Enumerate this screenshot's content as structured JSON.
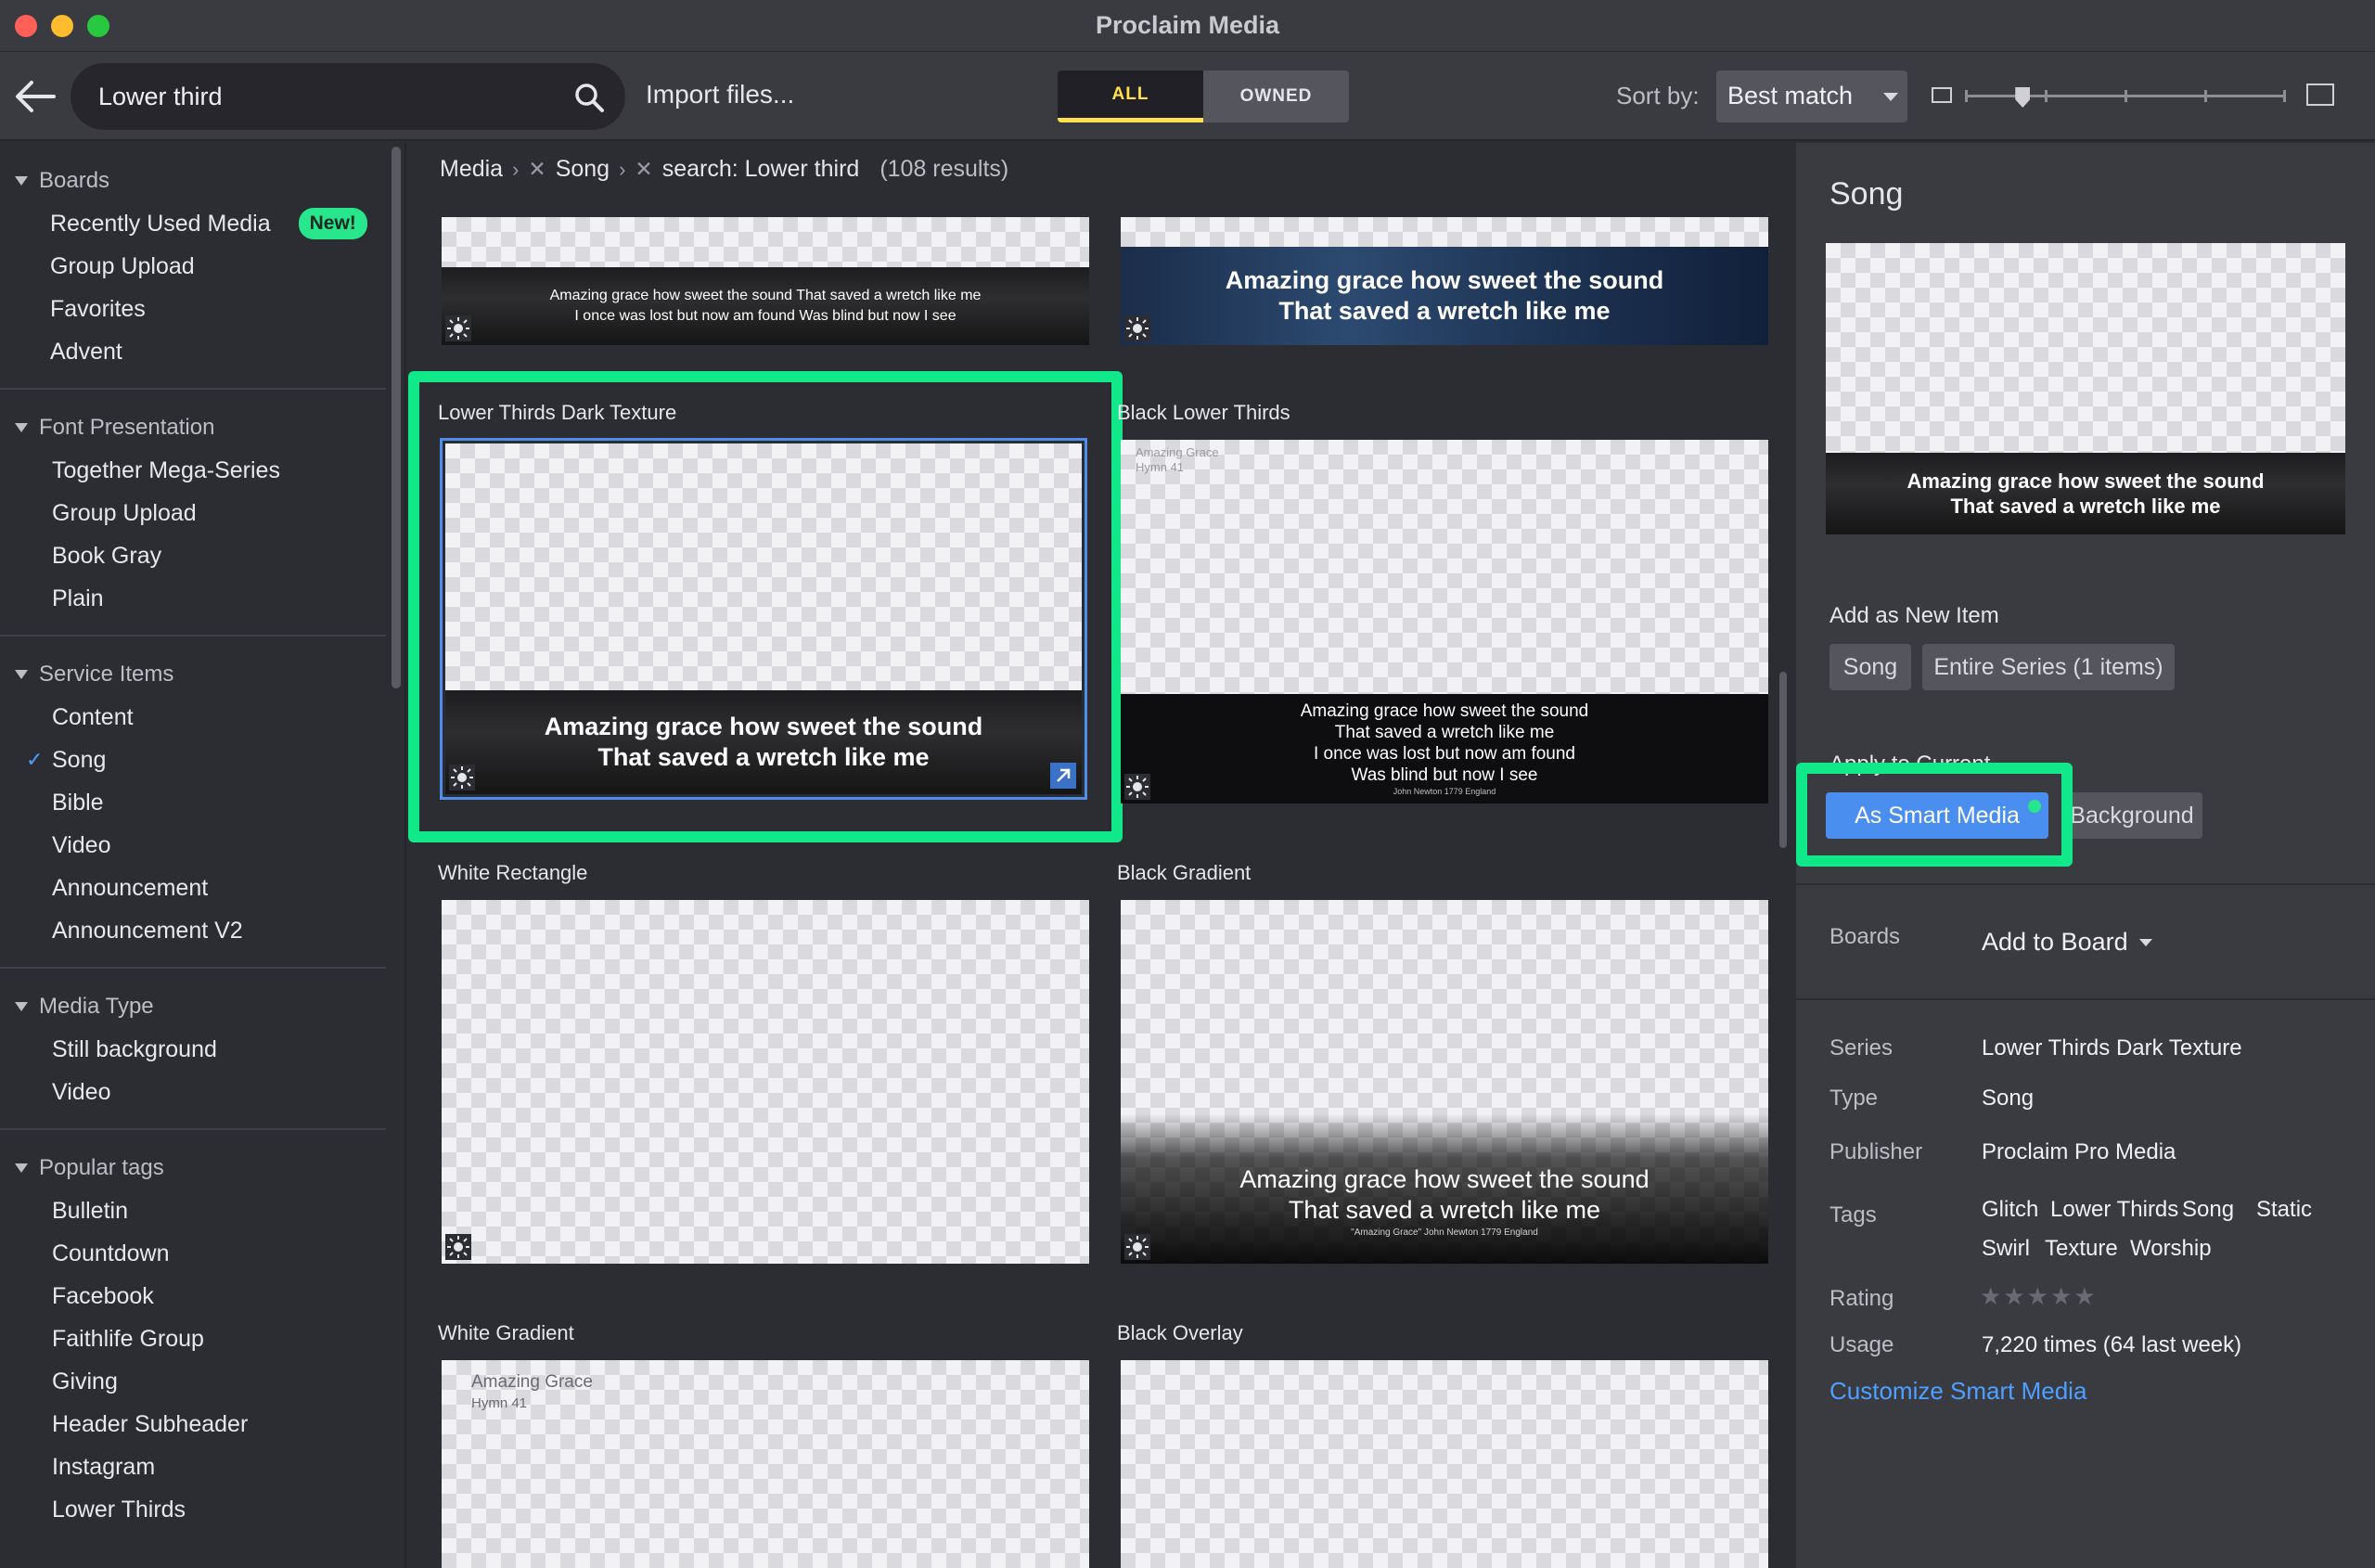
{
  "window": {
    "title": "Proclaim Media"
  },
  "toolbar": {
    "search_value": "Lower third",
    "import_label": "Import files...",
    "filter_all": "ALL",
    "filter_owned": "OWNED",
    "sort_label": "Sort by:",
    "sort_value": "Best match",
    "zoom_level": 0.18
  },
  "sidebar": {
    "groups": [
      {
        "title": "Boards",
        "items": [
          "Recently Used Media",
          "Group Upload",
          "Favorites",
          "Advent"
        ],
        "new_badge": "New!"
      },
      {
        "title": "Font Presentation",
        "items": [
          "Together Mega-Series",
          "Group Upload",
          "Book Gray",
          "Plain"
        ]
      },
      {
        "title": "Service Items",
        "items": [
          "Content",
          "Song",
          "Bible",
          "Video",
          "Announcement",
          "Announcement V2"
        ],
        "checked": "Song"
      },
      {
        "title": "Media Type",
        "items": [
          "Still background",
          "Video"
        ]
      },
      {
        "title": "Popular tags",
        "items": [
          "Bulletin",
          "Countdown",
          "Facebook",
          "Faithlife Group",
          "Giving",
          "Header Subheader",
          "Instagram",
          "Lower Thirds"
        ]
      }
    ]
  },
  "breadcrumb": {
    "root": "Media",
    "crumb1": "Song",
    "crumb2": "search: Lower third",
    "count": "(108 results)"
  },
  "grid": {
    "top_left_line1": "Amazing grace how sweet the sound That saved a wretch like me",
    "top_left_line2": "I once was lost but now am found Was blind but now I see",
    "top_right_line1": "Amazing grace how sweet the sound",
    "top_right_line2": "That saved a wretch like me",
    "card1_title": "Lower Thirds Dark Texture",
    "card1_line1": "Amazing grace how sweet the sound",
    "card1_line2": "That saved a wretch like me",
    "card2_title": "Black Lower Thirds",
    "card2_corner1": "Amazing Grace",
    "card2_corner2": "Hymn 41",
    "card2_line1": "Amazing grace how sweet the sound",
    "card2_line2": "That saved a wretch like me",
    "card2_line3": "I once was lost but now am found",
    "card2_line4": "Was blind but now I see",
    "card2_credit": "John Newton 1779 England",
    "card3_title": "White Rectangle",
    "card4_title": "Black Gradient",
    "card4_line1": "Amazing grace how sweet the sound",
    "card4_line2": "That saved a wretch like me",
    "card4_credit": "\"Amazing Grace\" John Newton 1779 England",
    "card5_title": "White Gradient",
    "card5_corner1": "Amazing Grace",
    "card5_corner2": "Hymn 41",
    "card6_title": "Black Overlay"
  },
  "panel": {
    "title": "Song",
    "preview_line1": "Amazing grace how sweet the sound",
    "preview_line2": "That saved a wretch like me",
    "add_new_label": "Add as New Item",
    "btn_song": "Song",
    "btn_series": "Entire Series (1 items)",
    "apply_label": "Apply to Current",
    "btn_smart": "As Smart Media",
    "btn_background": "Background",
    "boards_label": "Boards",
    "add_to_board": "Add to Board",
    "series_label": "Series",
    "series_value": "Lower Thirds Dark Texture",
    "type_label": "Type",
    "type_value": "Song",
    "publisher_label": "Publisher",
    "publisher_value": "Proclaim Pro Media",
    "tags_label": "Tags",
    "tags": [
      "Glitch",
      "Lower Thirds",
      "Song",
      "Static",
      "Swirl",
      "Texture",
      "Worship"
    ],
    "rating_label": "Rating",
    "rating_value": 0,
    "usage_label": "Usage",
    "usage_value": "7,220 times (64 last week)",
    "customize_link": "Customize Smart Media"
  },
  "colors": {
    "highlight": "#10e889",
    "accent_blue": "#4a8ef0",
    "filter_active": "#ffe04d",
    "badge_green": "#27e68c"
  }
}
